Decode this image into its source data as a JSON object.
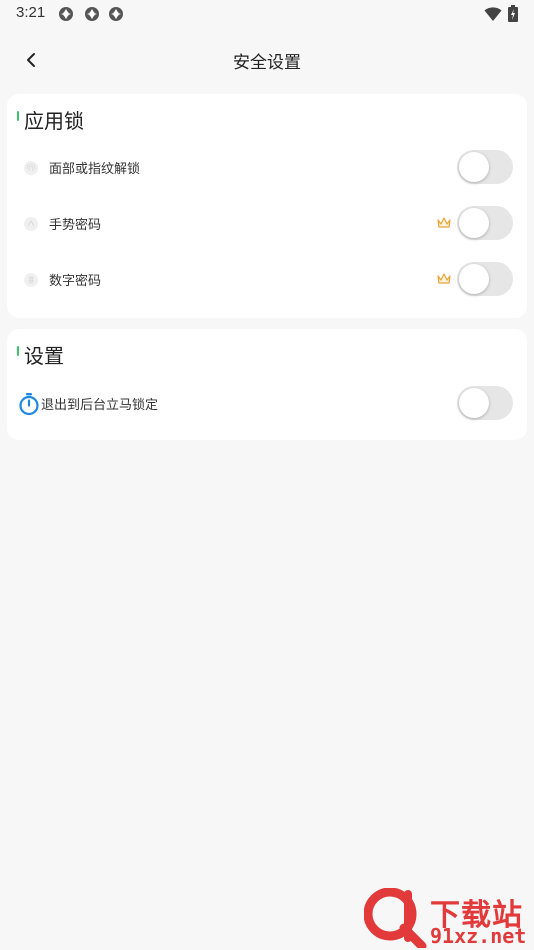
{
  "status_bar": {
    "time": "3:21",
    "notification_icons": [
      "app-notification-icon",
      "app-notification-icon",
      "app-notification-icon"
    ],
    "right_icons": [
      "wifi-icon",
      "battery-icon"
    ]
  },
  "header": {
    "title": "安全设置",
    "back_icon": "chevron-left-icon"
  },
  "app_lock": {
    "title": "应用锁",
    "items": [
      {
        "label": "面部或指纹解锁",
        "icon": "fingerprint-icon",
        "premium": false,
        "enabled": false
      },
      {
        "label": "手势密码",
        "icon": "gesture-icon",
        "premium": true,
        "enabled": false
      },
      {
        "label": "数字密码",
        "icon": "numeric-lock-icon",
        "premium": true,
        "enabled": false
      }
    ]
  },
  "settings": {
    "title": "设置",
    "items": [
      {
        "label": "退出到后台立马锁定",
        "icon": "stopwatch-icon",
        "enabled": false
      }
    ]
  },
  "watermark": {
    "brand": "下载站",
    "url": "91xz.net"
  },
  "colors": {
    "accent_green": "#3cc46a",
    "stopwatch_blue": "#1e88e5",
    "crown_orange": "#e8a23a",
    "watermark_red": "#e23a3a",
    "background": "#f7f7f7",
    "toggle_off": "#e6e6e6"
  }
}
